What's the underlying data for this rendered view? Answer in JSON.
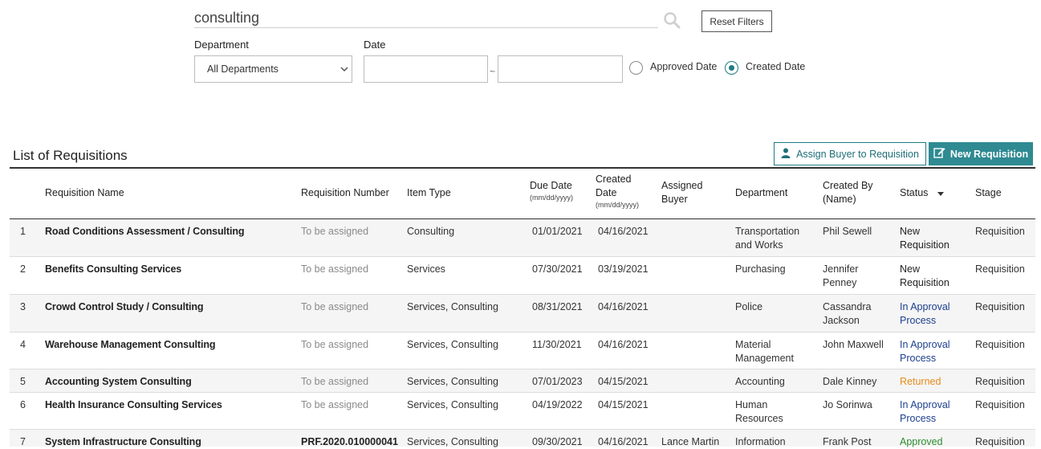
{
  "filters": {
    "search_value": "consulting",
    "reset_label": "Reset Filters",
    "department_label": "Department",
    "department_value": "All Departments",
    "date_label": "Date",
    "date_separator": "~",
    "radio_approved_label": "Approved Date",
    "radio_created_label": "Created Date",
    "selected_radio": "Created Date"
  },
  "list": {
    "title": "List of Requisitions",
    "assign_buyer_label": "Assign Buyer to Requisition",
    "new_requisition_label": "New Requisition"
  },
  "columns": {
    "name": "Requisition Name",
    "number": "Requisition Number",
    "item_type": "Item Type",
    "due_date": "Due Date",
    "due_date_fmt": "(mm/dd/yyyy)",
    "created_date_1": "Created",
    "created_date_2": "Date",
    "created_date_fmt": "(mm/dd/yyyy)",
    "buyer_1": "Assigned",
    "buyer_2": "Buyer",
    "department": "Department",
    "created_by_1": "Created By",
    "created_by_2": "(Name)",
    "status": "Status",
    "stage": "Stage"
  },
  "rows": [
    {
      "num": "1",
      "name": "Road Conditions Assessment / Consulting",
      "number": "To be assigned",
      "item_type": "Consulting",
      "due": "01/01/2021",
      "created": "04/16/2021",
      "buyer": "",
      "dept_1": "Transportation",
      "dept_2": "and Works",
      "by_1": "Phil Sewell",
      "by_2": "",
      "status_1": "New",
      "status_2": "Requisition",
      "status_kind": "new",
      "stage": "Requisition"
    },
    {
      "num": "2",
      "name": "Benefits Consulting Services",
      "number": "To be assigned",
      "item_type": "Services",
      "due": "07/30/2021",
      "created": "03/19/2021",
      "buyer": "",
      "dept_1": "Purchasing",
      "dept_2": "",
      "by_1": "Jennifer",
      "by_2": "Penney",
      "status_1": "New",
      "status_2": "Requisition",
      "status_kind": "new",
      "stage": "Requisition"
    },
    {
      "num": "3",
      "name": "Crowd Control Study / Consulting",
      "number": "To be assigned",
      "item_type": "Services, Consulting",
      "due": "08/31/2021",
      "created": "04/16/2021",
      "buyer": "",
      "dept_1": "Police",
      "dept_2": "",
      "by_1": "Cassandra",
      "by_2": "Jackson",
      "status_1": "In Approval",
      "status_2": "Process",
      "status_kind": "approval",
      "stage": "Requisition"
    },
    {
      "num": "4",
      "name": "Warehouse Management Consulting",
      "number": "To be assigned",
      "item_type": "Services, Consulting",
      "due": "11/30/2021",
      "created": "04/16/2021",
      "buyer": "",
      "dept_1": "Material",
      "dept_2": "Management",
      "by_1": "John Maxwell",
      "by_2": "",
      "status_1": "In Approval",
      "status_2": "Process",
      "status_kind": "approval",
      "stage": "Requisition"
    },
    {
      "num": "5",
      "name": "Accounting System Consulting",
      "number": "To be assigned",
      "item_type": "Services, Consulting",
      "due": "07/01/2023",
      "created": "04/15/2021",
      "buyer": "",
      "dept_1": "Accounting",
      "dept_2": "",
      "by_1": "Dale Kinney",
      "by_2": "",
      "status_1": "Returned",
      "status_2": "",
      "status_kind": "returned",
      "stage": "Requisition"
    },
    {
      "num": "6",
      "name": "Health Insurance Consulting Services",
      "number": "To be assigned",
      "item_type": "Services, Consulting",
      "due": "04/19/2022",
      "created": "04/15/2021",
      "buyer": "",
      "dept_1": "Human",
      "dept_2": "Resources",
      "by_1": "Jo Sorinwa",
      "by_2": "",
      "status_1": "In Approval",
      "status_2": "Process",
      "status_kind": "approval",
      "stage": "Requisition"
    },
    {
      "num": "7",
      "name": "System Infrastructure Consulting",
      "number": "PRF.2020.010000041",
      "item_type": "Services, Consulting",
      "due": "09/30/2021",
      "created": "04/16/2021",
      "buyer": "Lance Martin",
      "dept_1": "Information",
      "dept_2": "",
      "by_1": "Frank Post",
      "by_2": "",
      "status_1": "Approved",
      "status_2": "",
      "status_kind": "approved",
      "stage": "Requisition"
    }
  ],
  "colors": {
    "accent": "#2f8a92",
    "approval": "#1c3f8f",
    "returned": "#e98a1a",
    "approved": "#2e8b2e"
  },
  "icons": {
    "search": "search-icon",
    "user": "user-icon",
    "edit": "edit-icon",
    "chevron": "chevron-down-icon",
    "sort": "sort-down-icon"
  }
}
